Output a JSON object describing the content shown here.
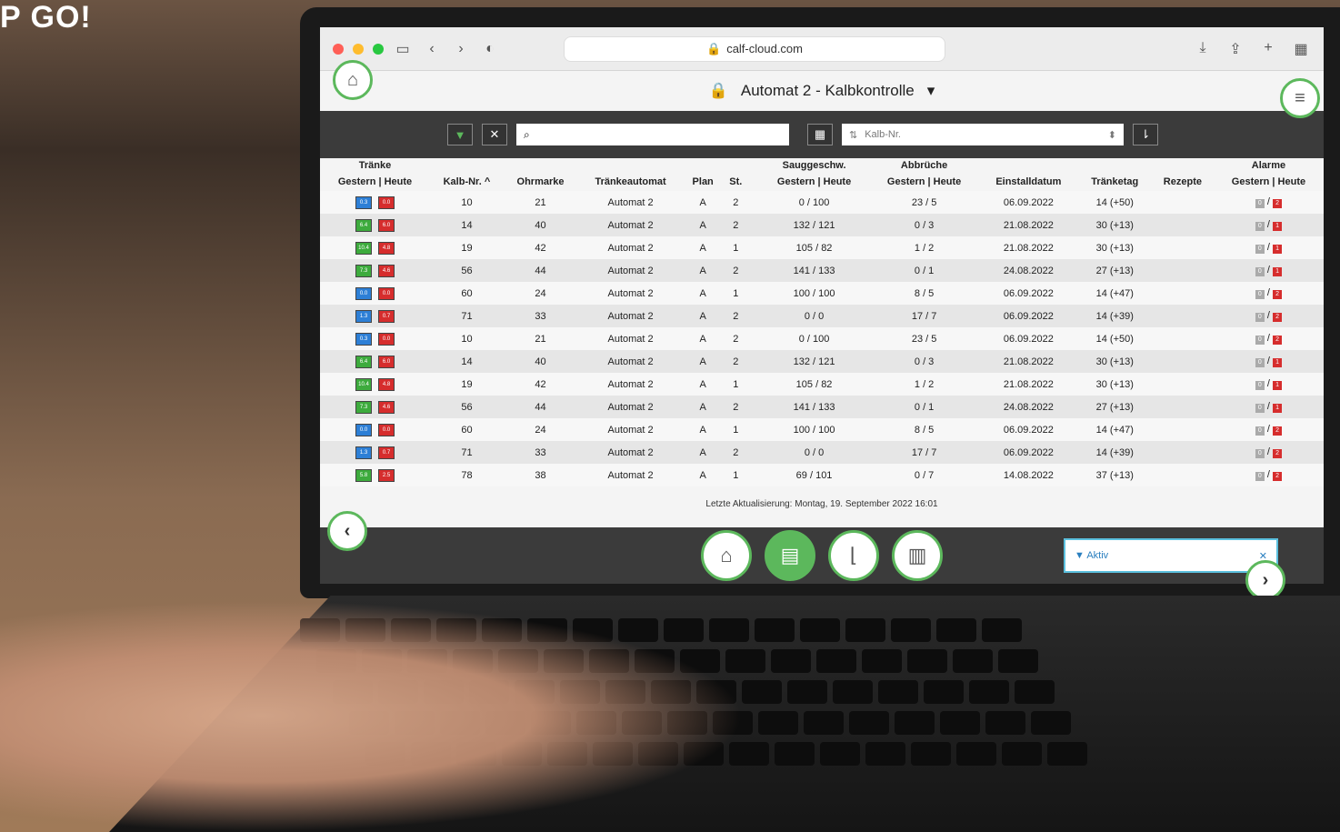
{
  "headline": "P GO!",
  "browser": {
    "url": "calf-cloud.com"
  },
  "header": {
    "title": "Automat 2 - Kalbkontrolle"
  },
  "toolbar": {
    "search_placeholder": "",
    "sort_label": "Kalb-Nr."
  },
  "table": {
    "group_headers": {
      "traenke": "Tränke",
      "sauggeschw": "Sauggeschw.",
      "abbrueche": "Abbrüche",
      "alarme": "Alarme"
    },
    "columns": {
      "gestern_heute": "Gestern | Heute",
      "kalb_nr": "Kalb-Nr.",
      "ohrmarke": "Ohrmarke",
      "traenkeautomat": "Tränkeautomat",
      "plan": "Plan",
      "st": "St.",
      "sauggeschw": "Gestern | Heute",
      "abbrueche": "Gestern | Heute",
      "einstalldatum": "Einstalldatum",
      "traenketag": "Tränketag",
      "rezepte": "Rezepte",
      "alarme": "Gestern | Heute"
    },
    "rows": [
      {
        "t1": "blue",
        "t1v": "0.3",
        "t2v": "0.0",
        "kalb": "10",
        "ohr": "21",
        "auto": "Automat 2",
        "plan": "A",
        "st": "2",
        "saug": "0 / 100",
        "abb": "23 / 5",
        "datum": "06.09.2022",
        "tag": "14 (+50)",
        "a1": "0",
        "a2": "2"
      },
      {
        "t1": "green",
        "t1v": "6.4",
        "t2v": "6.0",
        "kalb": "14",
        "ohr": "40",
        "auto": "Automat 2",
        "plan": "A",
        "st": "2",
        "saug": "132 / 121",
        "abb": "0 / 3",
        "datum": "21.08.2022",
        "tag": "30 (+13)",
        "a1": "0",
        "a2": "1"
      },
      {
        "t1": "green",
        "t1v": "10.4",
        "t2v": "4.8",
        "kalb": "19",
        "ohr": "42",
        "auto": "Automat 2",
        "plan": "A",
        "st": "1",
        "saug": "105 / 82",
        "abb": "1 / 2",
        "datum": "21.08.2022",
        "tag": "30 (+13)",
        "a1": "0",
        "a2": "1"
      },
      {
        "t1": "green",
        "t1v": "7.3",
        "t2v": "4.6",
        "kalb": "56",
        "ohr": "44",
        "auto": "Automat 2",
        "plan": "A",
        "st": "2",
        "saug": "141 / 133",
        "abb": "0 / 1",
        "datum": "24.08.2022",
        "tag": "27 (+13)",
        "a1": "0",
        "a2": "1"
      },
      {
        "t1": "blue",
        "t1v": "0.0",
        "t2v": "0.0",
        "kalb": "60",
        "ohr": "24",
        "auto": "Automat 2",
        "plan": "A",
        "st": "1",
        "saug": "100 / 100",
        "abb": "8 / 5",
        "datum": "06.09.2022",
        "tag": "14 (+47)",
        "a1": "0",
        "a2": "2"
      },
      {
        "t1": "blue",
        "t1v": "1.3",
        "t2v": "0.7",
        "kalb": "71",
        "ohr": "33",
        "auto": "Automat 2",
        "plan": "A",
        "st": "2",
        "saug": "0 / 0",
        "abb": "17 / 7",
        "datum": "06.09.2022",
        "tag": "14 (+39)",
        "a1": "0",
        "a2": "2"
      },
      {
        "t1": "blue",
        "t1v": "0.3",
        "t2v": "0.0",
        "kalb": "10",
        "ohr": "21",
        "auto": "Automat 2",
        "plan": "A",
        "st": "2",
        "saug": "0 / 100",
        "abb": "23 / 5",
        "datum": "06.09.2022",
        "tag": "14 (+50)",
        "a1": "0",
        "a2": "2"
      },
      {
        "t1": "green",
        "t1v": "6.4",
        "t2v": "6.0",
        "kalb": "14",
        "ohr": "40",
        "auto": "Automat 2",
        "plan": "A",
        "st": "2",
        "saug": "132 / 121",
        "abb": "0 / 3",
        "datum": "21.08.2022",
        "tag": "30 (+13)",
        "a1": "0",
        "a2": "1"
      },
      {
        "t1": "green",
        "t1v": "10.4",
        "t2v": "4.8",
        "kalb": "19",
        "ohr": "42",
        "auto": "Automat 2",
        "plan": "A",
        "st": "1",
        "saug": "105 / 82",
        "abb": "1 / 2",
        "datum": "21.08.2022",
        "tag": "30 (+13)",
        "a1": "0",
        "a2": "1"
      },
      {
        "t1": "green",
        "t1v": "7.3",
        "t2v": "4.6",
        "kalb": "56",
        "ohr": "44",
        "auto": "Automat 2",
        "plan": "A",
        "st": "2",
        "saug": "141 / 133",
        "abb": "0 / 1",
        "datum": "24.08.2022",
        "tag": "27 (+13)",
        "a1": "0",
        "a2": "1"
      },
      {
        "t1": "blue",
        "t1v": "0.0",
        "t2v": "0.0",
        "kalb": "60",
        "ohr": "24",
        "auto": "Automat 2",
        "plan": "A",
        "st": "1",
        "saug": "100 / 100",
        "abb": "8 / 5",
        "datum": "06.09.2022",
        "tag": "14 (+47)",
        "a1": "0",
        "a2": "2"
      },
      {
        "t1": "blue",
        "t1v": "1.3",
        "t2v": "0.7",
        "kalb": "71",
        "ohr": "33",
        "auto": "Automat 2",
        "plan": "A",
        "st": "2",
        "saug": "0 / 0",
        "abb": "17 / 7",
        "datum": "06.09.2022",
        "tag": "14 (+39)",
        "a1": "0",
        "a2": "2"
      },
      {
        "t1": "green",
        "t1v": "5.8",
        "t2v": "2.5",
        "kalb": "78",
        "ohr": "38",
        "auto": "Automat 2",
        "plan": "A",
        "st": "1",
        "saug": "69 / 101",
        "abb": "0 / 7",
        "datum": "14.08.2022",
        "tag": "37 (+13)",
        "a1": "0",
        "a2": "2"
      }
    ]
  },
  "footer": {
    "last_update": "Letzte Aktualisierung: Montag, 19. September 2022 16:01"
  },
  "filter_chip": {
    "label": "Aktiv"
  }
}
